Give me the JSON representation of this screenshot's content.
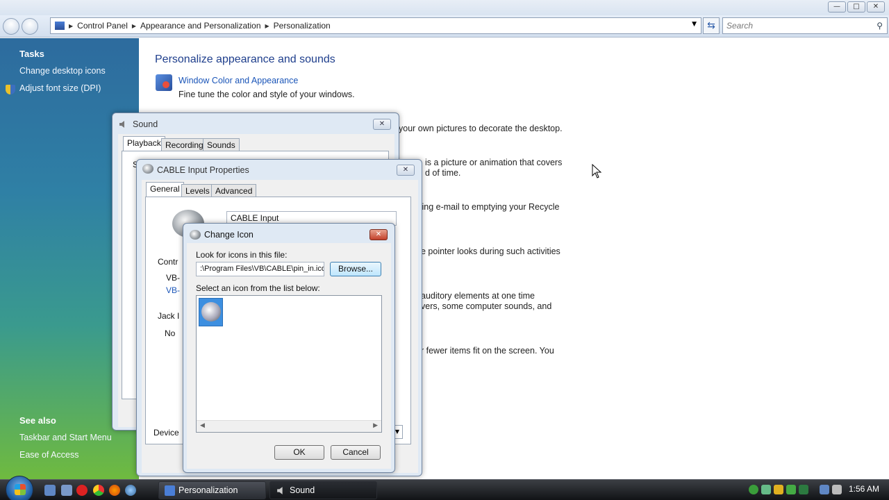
{
  "explorer": {
    "breadcrumbs": [
      "Control Panel",
      "Appearance and Personalization",
      "Personalization"
    ],
    "search_placeholder": "Search",
    "window_controls": [
      "minimize",
      "maximize",
      "close"
    ]
  },
  "taskpane": {
    "tasks_heading": "Tasks",
    "tasks": [
      "Change desktop icons",
      "Adjust font size (DPI)"
    ],
    "see_also_heading": "See also",
    "see_also": [
      "Taskbar and Start Menu",
      "Ease of Access"
    ]
  },
  "main": {
    "title": "Personalize appearance and sounds",
    "window_color_link": "Window Color and Appearance",
    "window_color_desc": "Fine tune the color and style of your windows.",
    "fragments": [
      "your own pictures to decorate the desktop.",
      "is a picture or animation that covers",
      "d of time.",
      "ting e-mail to emptying your Recycle",
      "e pointer looks during such activities",
      "auditory elements at one time",
      "vers, some computer sounds, and",
      "r fewer items fit on the screen. You"
    ]
  },
  "sound_dialog": {
    "title": "Sound",
    "tabs": [
      "Playback",
      "Recording",
      "Sounds"
    ],
    "active_tab": "Playback",
    "partial_label": "S"
  },
  "cable_dialog": {
    "title": "CABLE Input Properties",
    "tabs": [
      "General",
      "Levels",
      "Advanced"
    ],
    "active_tab": "General",
    "name_value": "CABLE Input",
    "controller_label": "Contr",
    "controller_line1": "VB-",
    "controller_line2": "VB-",
    "jack_label": "Jack I",
    "jack_value": "No",
    "device_label": "Device"
  },
  "change_icon_dialog": {
    "title": "Change Icon",
    "look_for_label": "Look for icons in this file:",
    "file_path": ":\\Program Files\\VB\\CABLE\\pin_in.ico",
    "browse_label": "Browse...",
    "select_label": "Select an icon from the list below:",
    "ok_label": "OK",
    "cancel_label": "Cancel"
  },
  "taskbar": {
    "buttons": [
      "Personalization",
      "Sound"
    ],
    "clock": "1:56 AM"
  },
  "colors": {
    "link": "#1a55b8",
    "title_blue": "#1e3e8c",
    "taskbar": "#1b1d21"
  }
}
